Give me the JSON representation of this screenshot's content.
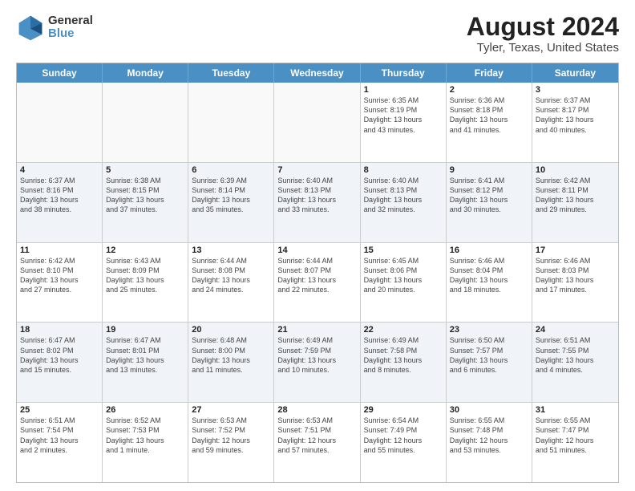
{
  "header": {
    "logo": {
      "line1": "General",
      "line2": "Blue"
    },
    "title": "August 2024",
    "subtitle": "Tyler, Texas, United States"
  },
  "weekdays": [
    "Sunday",
    "Monday",
    "Tuesday",
    "Wednesday",
    "Thursday",
    "Friday",
    "Saturday"
  ],
  "rows": [
    [
      {
        "day": "",
        "info": "",
        "empty": true
      },
      {
        "day": "",
        "info": "",
        "empty": true
      },
      {
        "day": "",
        "info": "",
        "empty": true
      },
      {
        "day": "",
        "info": "",
        "empty": true
      },
      {
        "day": "1",
        "info": "Sunrise: 6:35 AM\nSunset: 8:19 PM\nDaylight: 13 hours\nand 43 minutes."
      },
      {
        "day": "2",
        "info": "Sunrise: 6:36 AM\nSunset: 8:18 PM\nDaylight: 13 hours\nand 41 minutes."
      },
      {
        "day": "3",
        "info": "Sunrise: 6:37 AM\nSunset: 8:17 PM\nDaylight: 13 hours\nand 40 minutes."
      }
    ],
    [
      {
        "day": "4",
        "info": "Sunrise: 6:37 AM\nSunset: 8:16 PM\nDaylight: 13 hours\nand 38 minutes."
      },
      {
        "day": "5",
        "info": "Sunrise: 6:38 AM\nSunset: 8:15 PM\nDaylight: 13 hours\nand 37 minutes."
      },
      {
        "day": "6",
        "info": "Sunrise: 6:39 AM\nSunset: 8:14 PM\nDaylight: 13 hours\nand 35 minutes."
      },
      {
        "day": "7",
        "info": "Sunrise: 6:40 AM\nSunset: 8:13 PM\nDaylight: 13 hours\nand 33 minutes."
      },
      {
        "day": "8",
        "info": "Sunrise: 6:40 AM\nSunset: 8:13 PM\nDaylight: 13 hours\nand 32 minutes."
      },
      {
        "day": "9",
        "info": "Sunrise: 6:41 AM\nSunset: 8:12 PM\nDaylight: 13 hours\nand 30 minutes."
      },
      {
        "day": "10",
        "info": "Sunrise: 6:42 AM\nSunset: 8:11 PM\nDaylight: 13 hours\nand 29 minutes."
      }
    ],
    [
      {
        "day": "11",
        "info": "Sunrise: 6:42 AM\nSunset: 8:10 PM\nDaylight: 13 hours\nand 27 minutes."
      },
      {
        "day": "12",
        "info": "Sunrise: 6:43 AM\nSunset: 8:09 PM\nDaylight: 13 hours\nand 25 minutes."
      },
      {
        "day": "13",
        "info": "Sunrise: 6:44 AM\nSunset: 8:08 PM\nDaylight: 13 hours\nand 24 minutes."
      },
      {
        "day": "14",
        "info": "Sunrise: 6:44 AM\nSunset: 8:07 PM\nDaylight: 13 hours\nand 22 minutes."
      },
      {
        "day": "15",
        "info": "Sunrise: 6:45 AM\nSunset: 8:06 PM\nDaylight: 13 hours\nand 20 minutes."
      },
      {
        "day": "16",
        "info": "Sunrise: 6:46 AM\nSunset: 8:04 PM\nDaylight: 13 hours\nand 18 minutes."
      },
      {
        "day": "17",
        "info": "Sunrise: 6:46 AM\nSunset: 8:03 PM\nDaylight: 13 hours\nand 17 minutes."
      }
    ],
    [
      {
        "day": "18",
        "info": "Sunrise: 6:47 AM\nSunset: 8:02 PM\nDaylight: 13 hours\nand 15 minutes."
      },
      {
        "day": "19",
        "info": "Sunrise: 6:47 AM\nSunset: 8:01 PM\nDaylight: 13 hours\nand 13 minutes."
      },
      {
        "day": "20",
        "info": "Sunrise: 6:48 AM\nSunset: 8:00 PM\nDaylight: 13 hours\nand 11 minutes."
      },
      {
        "day": "21",
        "info": "Sunrise: 6:49 AM\nSunset: 7:59 PM\nDaylight: 13 hours\nand 10 minutes."
      },
      {
        "day": "22",
        "info": "Sunrise: 6:49 AM\nSunset: 7:58 PM\nDaylight: 13 hours\nand 8 minutes."
      },
      {
        "day": "23",
        "info": "Sunrise: 6:50 AM\nSunset: 7:57 PM\nDaylight: 13 hours\nand 6 minutes."
      },
      {
        "day": "24",
        "info": "Sunrise: 6:51 AM\nSunset: 7:55 PM\nDaylight: 13 hours\nand 4 minutes."
      }
    ],
    [
      {
        "day": "25",
        "info": "Sunrise: 6:51 AM\nSunset: 7:54 PM\nDaylight: 13 hours\nand 2 minutes."
      },
      {
        "day": "26",
        "info": "Sunrise: 6:52 AM\nSunset: 7:53 PM\nDaylight: 13 hours\nand 1 minute."
      },
      {
        "day": "27",
        "info": "Sunrise: 6:53 AM\nSunset: 7:52 PM\nDaylight: 12 hours\nand 59 minutes."
      },
      {
        "day": "28",
        "info": "Sunrise: 6:53 AM\nSunset: 7:51 PM\nDaylight: 12 hours\nand 57 minutes."
      },
      {
        "day": "29",
        "info": "Sunrise: 6:54 AM\nSunset: 7:49 PM\nDaylight: 12 hours\nand 55 minutes."
      },
      {
        "day": "30",
        "info": "Sunrise: 6:55 AM\nSunset: 7:48 PM\nDaylight: 12 hours\nand 53 minutes."
      },
      {
        "day": "31",
        "info": "Sunrise: 6:55 AM\nSunset: 7:47 PM\nDaylight: 12 hours\nand 51 minutes."
      }
    ]
  ]
}
